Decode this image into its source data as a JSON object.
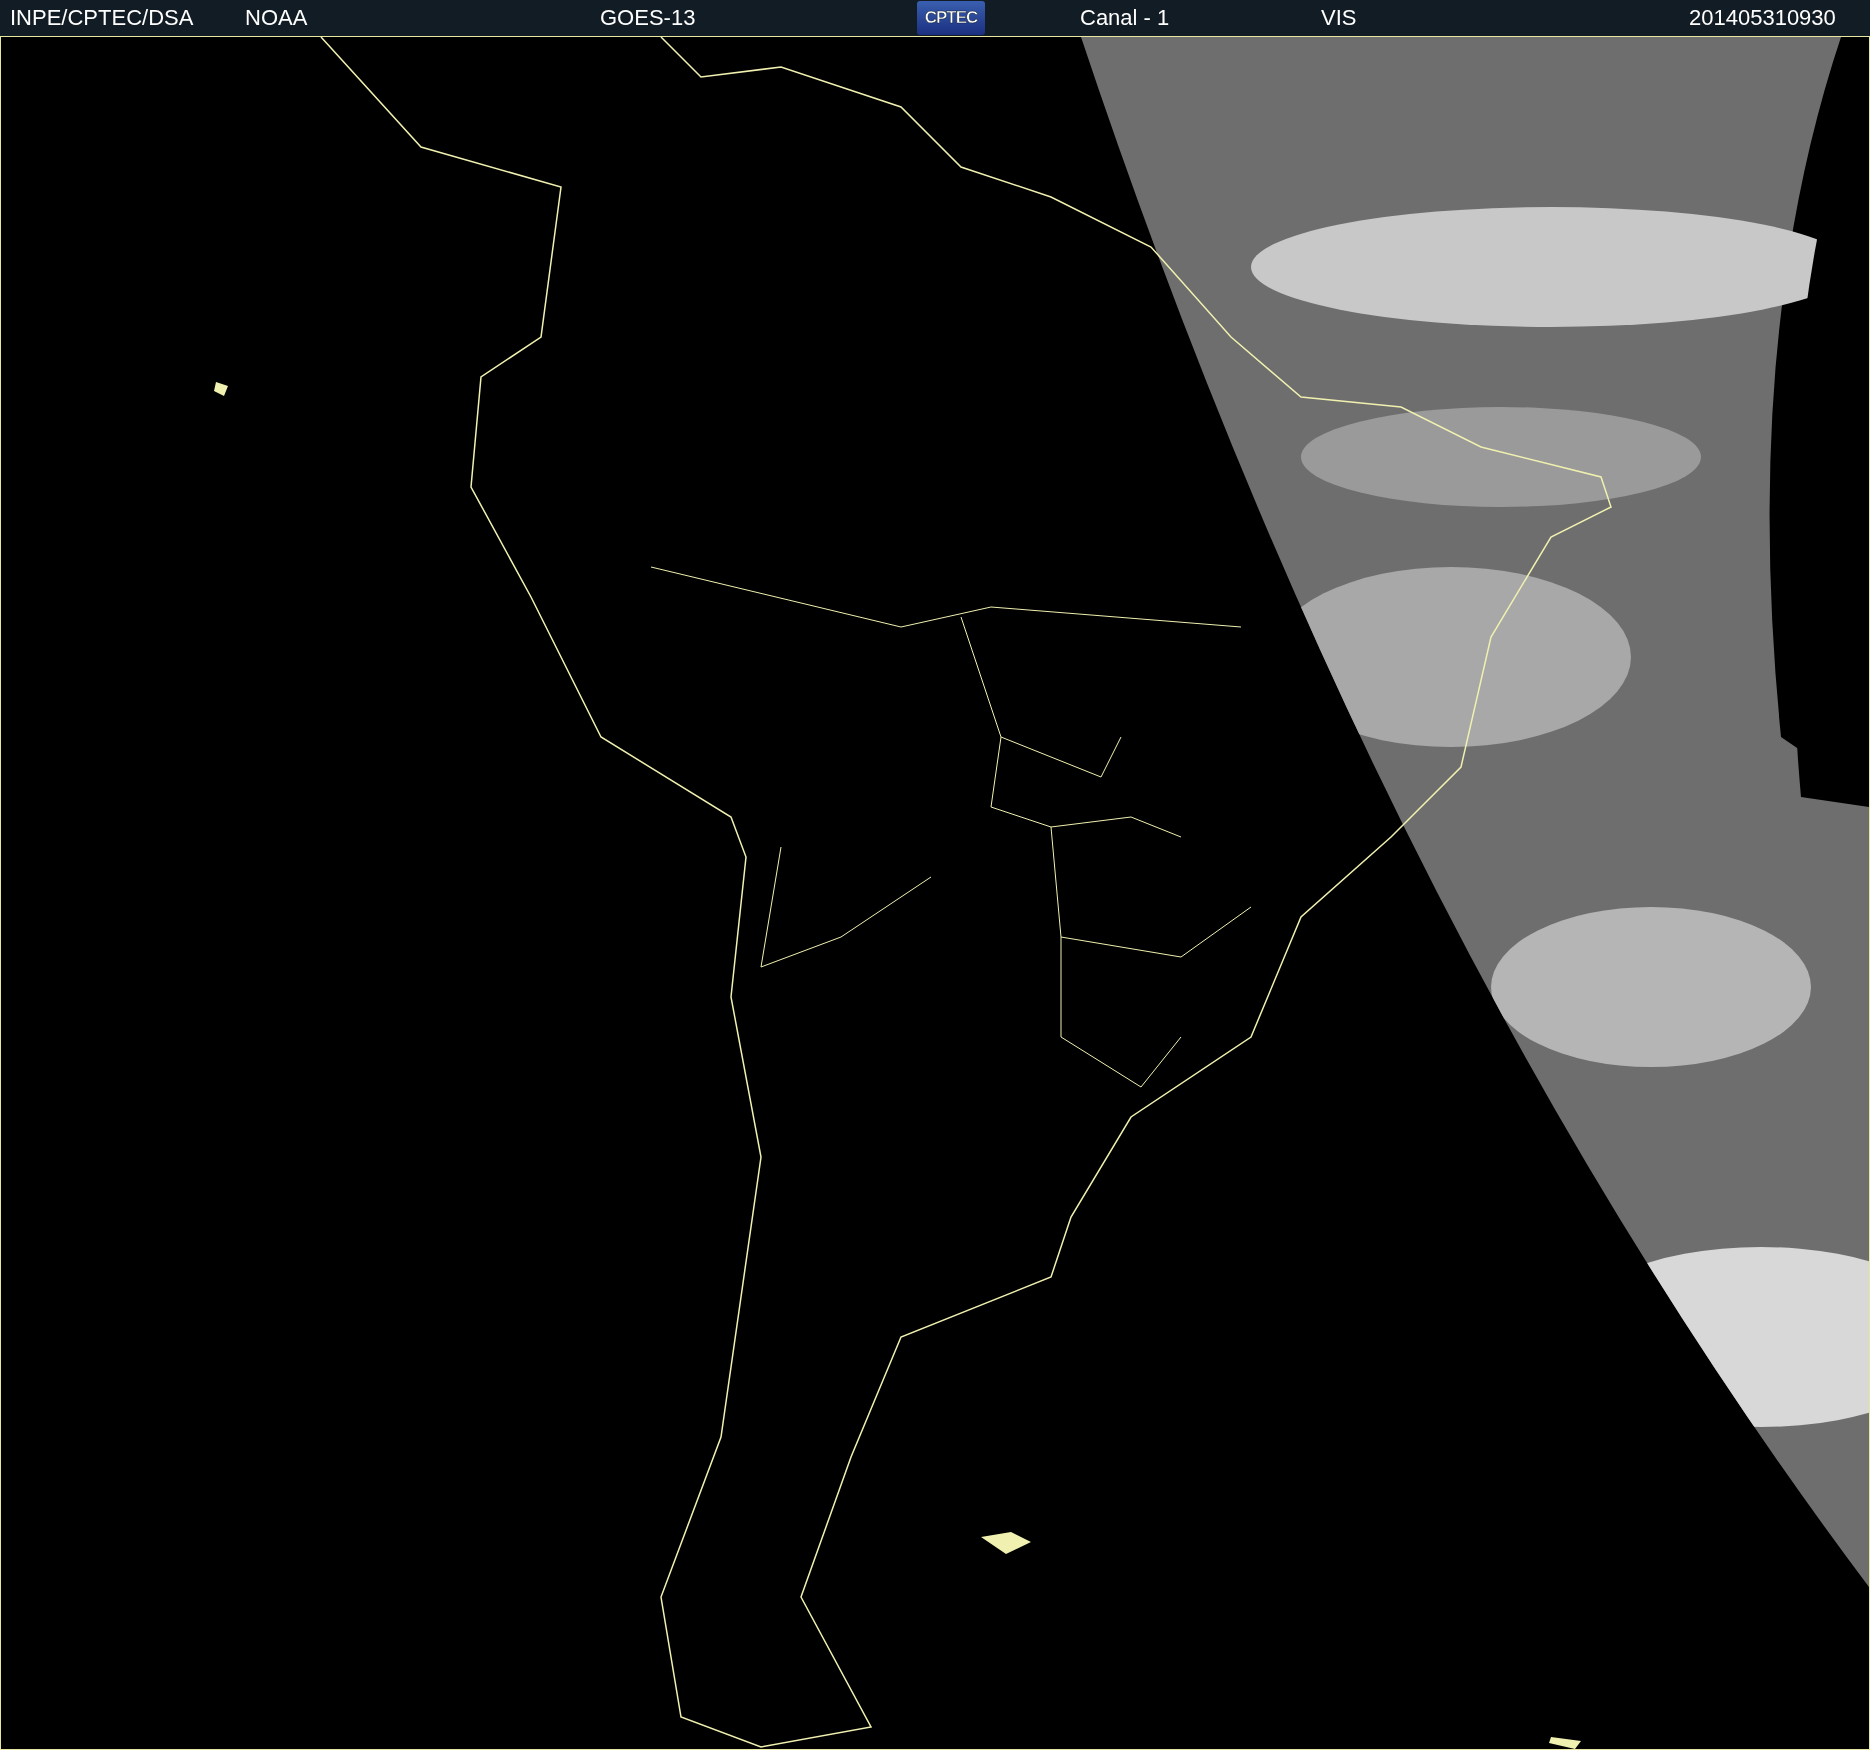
{
  "header": {
    "source": "INPE/CPTEC/DSA",
    "agency": "NOAA",
    "satellite": "GOES-13",
    "logo": "CPTEC",
    "channel": "Canal - 1",
    "band": "VIS",
    "timestamp": "201405310930"
  }
}
